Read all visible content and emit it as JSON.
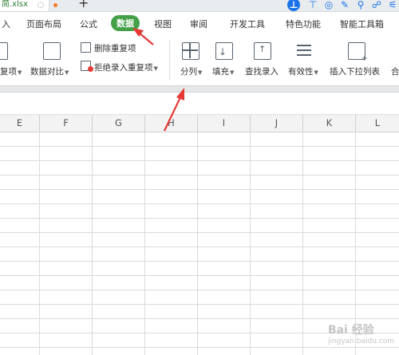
{
  "titlebar": {
    "file_tab_label": "简.xlsx",
    "new_tab": "+"
  },
  "menu": {
    "items": [
      "入",
      "页面布局",
      "公式",
      "数据",
      "视图",
      "审阅",
      "开发工具",
      "特色功能",
      "智能工具箱"
    ],
    "active": "数据"
  },
  "ribbon": {
    "remove_duplicates_left": "复项",
    "data_compare": "数据对比",
    "delete_duplicates": "删除重复项",
    "reject_duplicates": "拒绝录入重复项",
    "split_columns": "分列",
    "fill": "填充",
    "find_entry": "查找录入",
    "validity": "有效性",
    "insert_dropdown": "插入下拉列表",
    "merge_cut": "合"
  },
  "grid": {
    "columns": [
      "E",
      "F",
      "G",
      "H",
      "I",
      "J",
      "K",
      "L"
    ]
  },
  "colors": {
    "active_tab": "#43a047",
    "annotation_arrow": "#e53935",
    "accent_blue": "#1a73e8"
  },
  "watermark": {
    "text": "Bai 经验",
    "sub": "jingyan.baidu.com"
  }
}
